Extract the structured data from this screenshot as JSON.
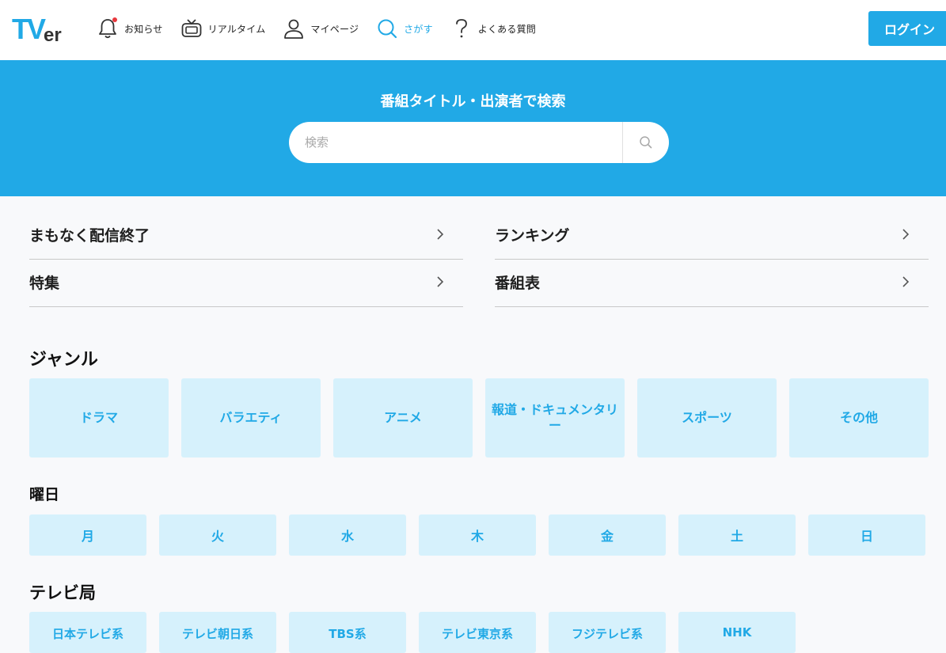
{
  "header": {
    "logo_text": "TVer",
    "nav": [
      {
        "label": "お知らせ",
        "icon": "bell-icon"
      },
      {
        "label": "リアルタイム",
        "icon": "tv-icon"
      },
      {
        "label": "マイページ",
        "icon": "user-icon"
      },
      {
        "label": "さがす",
        "icon": "search-icon"
      },
      {
        "label": "よくある質問",
        "icon": "question-icon"
      }
    ],
    "login_label": "ログイン"
  },
  "hero": {
    "title": "番組タイトル・出演者で検索",
    "search_placeholder": "検索"
  },
  "links": [
    {
      "label": "まもなく配信終了"
    },
    {
      "label": "ランキング"
    },
    {
      "label": "特集"
    },
    {
      "label": "番組表"
    }
  ],
  "genre": {
    "title": "ジャンル",
    "items": [
      "ドラマ",
      "バラエティ",
      "アニメ",
      "報道・ドキュメンタリー",
      "スポーツ",
      "その他"
    ]
  },
  "weekday": {
    "title": "曜日",
    "items": [
      "月",
      "火",
      "水",
      "木",
      "金",
      "土",
      "日"
    ]
  },
  "tv_station": {
    "title": "テレビ局",
    "items": [
      "日本テレビ系",
      "テレビ朝日系",
      "TBS系",
      "テレビ東京系",
      "フジテレビ系",
      "NHK"
    ]
  },
  "colors": {
    "accent": "#21a9e6",
    "tile_bg": "#d6f1fc",
    "notification_dot": "#e8383d"
  }
}
